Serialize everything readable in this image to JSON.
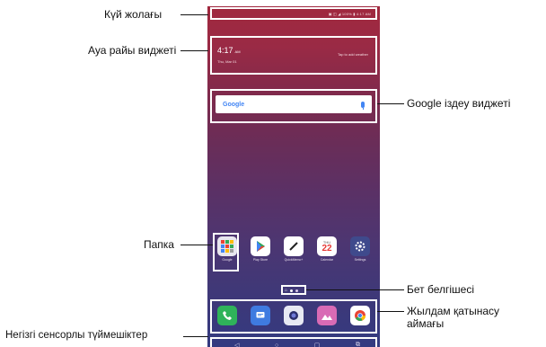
{
  "callouts": {
    "status_bar": "Күй жолағы",
    "weather_widget": "Ауа райы виджеті",
    "google_widget": "Google іздеу виджеті",
    "folder": "Папка",
    "page_indicator": "Бет белгішесі",
    "quick_access_line1": "Жылдам қатынасу",
    "quick_access_line2": "аймағы",
    "home_touch_buttons": "Негізгі сенсорлы түймешіктер"
  },
  "phone": {
    "status": {
      "text": "▣ ◫ ◢ 100% ▮ 4:17 AM"
    },
    "weather": {
      "time": "4:17",
      "ampm": "AM",
      "date": "Thu, Mar 01",
      "tap": "Tap to add weather"
    },
    "google": {
      "logo": "Google"
    },
    "apps": [
      {
        "label": "Google",
        "icon": "folder-icon"
      },
      {
        "label": "Play Store",
        "icon": "play-store-icon"
      },
      {
        "label": "QuickMemo+",
        "icon": "pen-icon"
      },
      {
        "label": "Calendar",
        "icon": "calendar-icon",
        "day_name": "THU",
        "day": "22"
      },
      {
        "label": "Settings",
        "icon": "gear-icon"
      }
    ],
    "page_indicator": {
      "home_glyph": "⌂"
    },
    "dock": [
      {
        "icon": "phone-icon"
      },
      {
        "icon": "messages-icon"
      },
      {
        "icon": "camera-icon"
      },
      {
        "icon": "gallery-icon"
      },
      {
        "icon": "chrome-icon"
      }
    ],
    "navbar": {
      "back": "◁",
      "home": "○",
      "recents": "▢",
      "dual": "⧉"
    }
  },
  "colors": {
    "accent_frame": "#ffffff",
    "wallpaper_top": "#a0283e",
    "wallpaper_bottom": "#343a80"
  }
}
